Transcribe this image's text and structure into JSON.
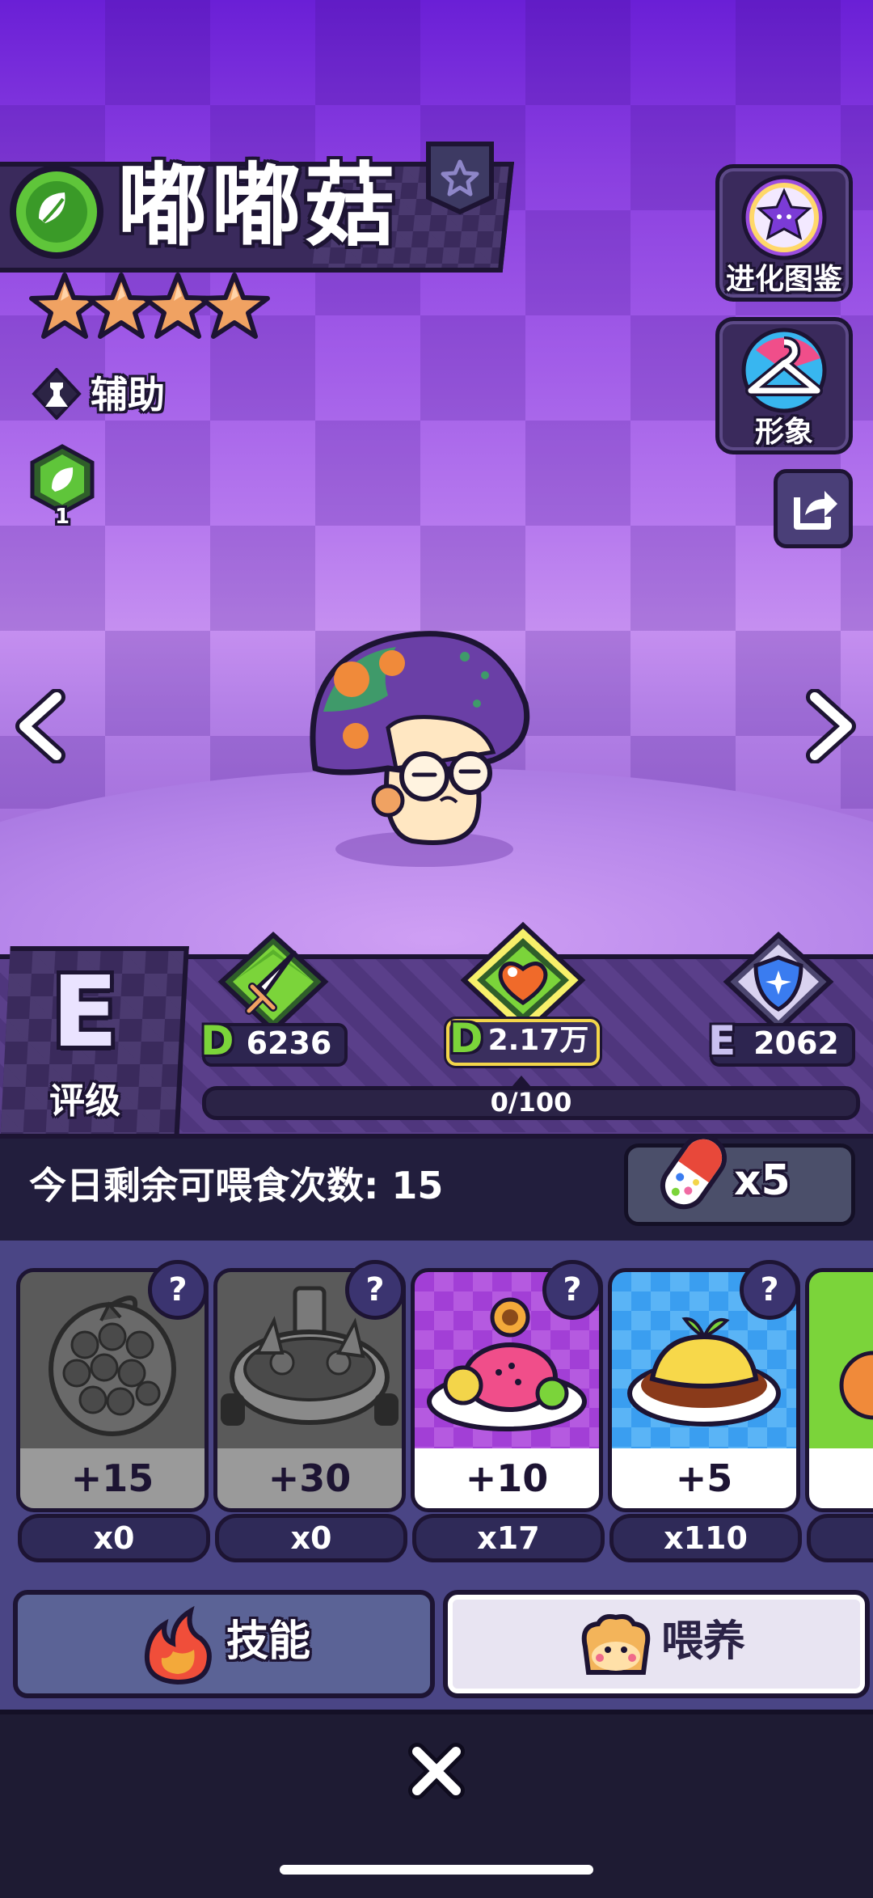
{
  "character": {
    "name": "嘟嘟菇",
    "stars": 4,
    "role_label": "辅助",
    "badge_level": "1"
  },
  "side_buttons": {
    "evolution_label": "进化图鉴",
    "appearance_label": "形象"
  },
  "stats": {
    "attack": {
      "grade": "D",
      "value": "6236"
    },
    "hp": {
      "grade": "D",
      "value": "2.17万"
    },
    "defense": {
      "grade": "E",
      "value": "2062"
    }
  },
  "rating": {
    "grade": "E",
    "label": "评级"
  },
  "progress": {
    "text": "0/100",
    "fraction": 0
  },
  "feed": {
    "remaining_text": "今日剩余可喂食次数: 15",
    "item_count": "x5"
  },
  "foods": [
    {
      "value": "+15",
      "count": "x0",
      "locked": true
    },
    {
      "value": "+30",
      "count": "x0",
      "locked": true
    },
    {
      "value": "+10",
      "count": "x17",
      "locked": false
    },
    {
      "value": "+5",
      "count": "x110",
      "locked": false
    }
  ],
  "tabs": {
    "skill_label": "技能",
    "feed_label": "喂养"
  },
  "colors": {
    "purple_bg": "#8a3fe0",
    "green_grade": "#7bd43a",
    "star": "#f0a262",
    "dark_outline": "#1d1433"
  }
}
